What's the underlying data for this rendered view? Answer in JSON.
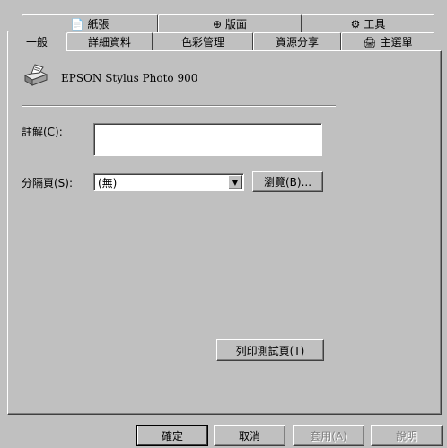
{
  "tabs_back": [
    {
      "label": "紙張",
      "icon": "paper-icon",
      "glyph": "📄"
    },
    {
      "label": "版面",
      "icon": "layout-icon",
      "glyph": "⊕"
    },
    {
      "label": "工具",
      "icon": "tools-icon",
      "glyph": "⚙"
    }
  ],
  "tabs_front": [
    {
      "label": "一般",
      "active": true
    },
    {
      "label": "詳細資料"
    },
    {
      "label": "色彩管理"
    },
    {
      "label": "資源分享"
    },
    {
      "label": "主選單",
      "icon": "main-menu-icon",
      "glyph": "🖨"
    }
  ],
  "printer": {
    "name": "EPSON Stylus Photo 900",
    "icon": "printer-icon"
  },
  "comment": {
    "label": "註解(C):",
    "value": ""
  },
  "separator_page": {
    "label": "分隔頁(S):",
    "value": "(無)",
    "browse_label": "瀏覽(B)..."
  },
  "print_test_label": "列印測試頁(T)",
  "footer": {
    "ok": "確定",
    "cancel": "取消",
    "apply": "套用(A)",
    "help": "說明"
  }
}
